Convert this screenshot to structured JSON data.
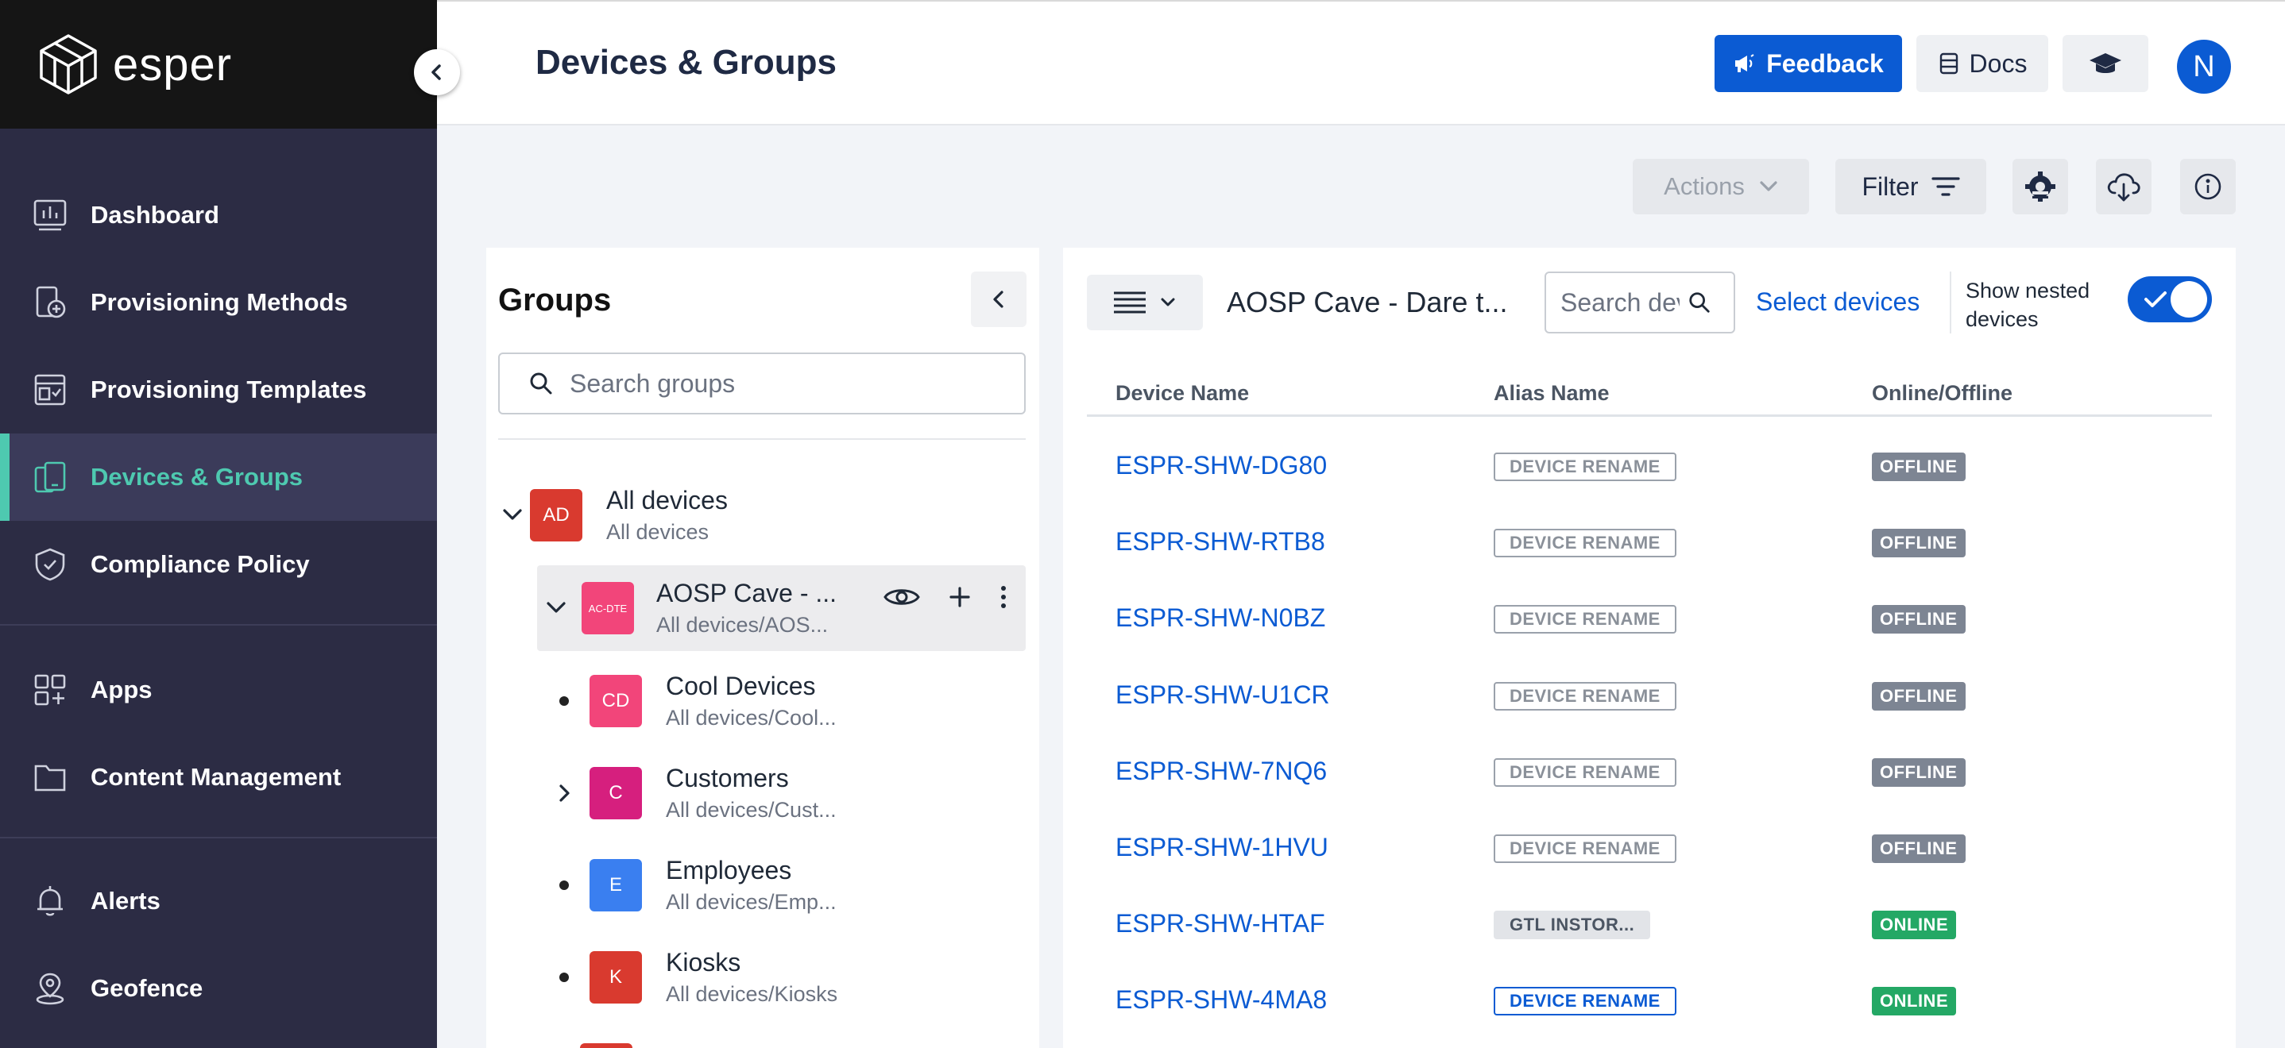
{
  "app": {
    "brand": "esper",
    "page_title": "Devices & Groups"
  },
  "header": {
    "feedback_label": "Feedback",
    "docs_label": "Docs",
    "avatar_initial": "N"
  },
  "sidebar": {
    "items": [
      {
        "label": "Dashboard",
        "icon": "dashboard-icon"
      },
      {
        "label": "Provisioning Methods",
        "icon": "provisioning-methods-icon"
      },
      {
        "label": "Provisioning Templates",
        "icon": "provisioning-templates-icon"
      },
      {
        "label": "Devices & Groups",
        "icon": "devices-icon",
        "active": true
      },
      {
        "label": "Compliance Policy",
        "icon": "shield-icon"
      },
      {
        "label": "Apps",
        "icon": "apps-icon"
      },
      {
        "label": "Content Management",
        "icon": "folder-icon"
      },
      {
        "label": "Alerts",
        "icon": "bell-icon"
      },
      {
        "label": "Geofence",
        "icon": "geofence-icon"
      }
    ]
  },
  "toolbar": {
    "actions_label": "Actions",
    "filter_label": "Filter"
  },
  "groups": {
    "title": "Groups",
    "search_placeholder": "Search groups",
    "tree": [
      {
        "badge": "AD",
        "name": "All devices",
        "path": "All devices",
        "color": "#d93a2f"
      },
      {
        "badge": "AC-DTE",
        "name": "AOSP Cave - ...",
        "path": "All devices/AOS...",
        "color": "#f2457a"
      },
      {
        "badge": "CD",
        "name": "Cool Devices",
        "path": "All devices/Cool...",
        "color": "#f2457a"
      },
      {
        "badge": "C",
        "name": "Customers",
        "path": "All devices/Cust...",
        "color": "#d61f7e"
      },
      {
        "badge": "E",
        "name": "Employees",
        "path": "All devices/Emp...",
        "color": "#3a7ff0"
      },
      {
        "badge": "K",
        "name": "Kiosks",
        "path": "All devices/Kiosks",
        "color": "#d93a2f"
      }
    ]
  },
  "devices": {
    "group_title": "AOSP Cave - Dare t...",
    "search_placeholder": "Search devices",
    "select_devices_label": "Select devices",
    "show_nested_label": "Show nested devices",
    "show_nested_on": true,
    "columns": [
      "Device Name",
      "Alias Name",
      "Online/Offline"
    ],
    "rows": [
      {
        "name": "ESPR-SHW-DG80",
        "alias": "DEVICE RENAME",
        "alias_style": "outline",
        "status": "OFFLINE"
      },
      {
        "name": "ESPR-SHW-RTB8",
        "alias": "DEVICE RENAME",
        "alias_style": "outline",
        "status": "OFFLINE"
      },
      {
        "name": "ESPR-SHW-N0BZ",
        "alias": "DEVICE RENAME",
        "alias_style": "outline",
        "status": "OFFLINE"
      },
      {
        "name": "ESPR-SHW-U1CR",
        "alias": "DEVICE RENAME",
        "alias_style": "outline",
        "status": "OFFLINE"
      },
      {
        "name": "ESPR-SHW-7NQ6",
        "alias": "DEVICE RENAME",
        "alias_style": "outline",
        "status": "OFFLINE"
      },
      {
        "name": "ESPR-SHW-1HVU",
        "alias": "DEVICE RENAME",
        "alias_style": "outline",
        "status": "OFFLINE"
      },
      {
        "name": "ESPR-SHW-HTAF",
        "alias": "GTL INSTOR...",
        "alias_style": "filled",
        "status": "ONLINE"
      },
      {
        "name": "ESPR-SHW-4MA8",
        "alias": "DEVICE RENAME",
        "alias_style": "blue",
        "status": "ONLINE"
      }
    ]
  },
  "colors": {
    "accent_blue": "#0b5bd3",
    "sidebar_bg": "#2c2c44",
    "active_teal": "#4ec9b0",
    "online_green": "#24a865",
    "offline_grey": "#7d8593"
  }
}
